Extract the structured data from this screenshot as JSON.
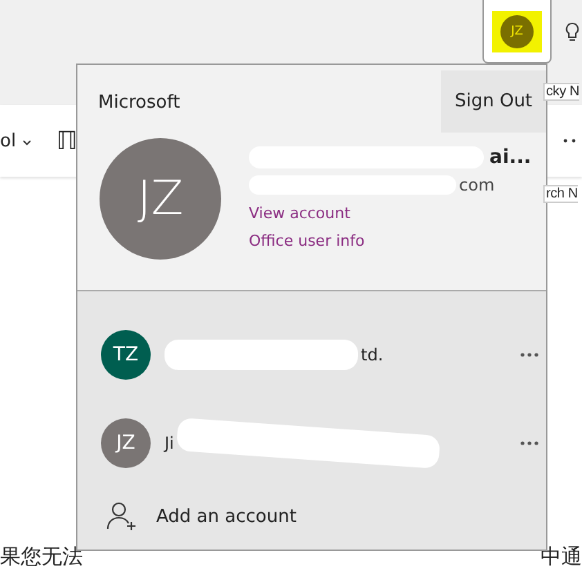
{
  "toolbar": {
    "avatar_initials": "JZ",
    "highlighted": true,
    "ribbon_items": [
      "ol",
      "ℿ"
    ],
    "side_labels": [
      "cky N",
      "rch N"
    ]
  },
  "document": {
    "text_left": "果您无法",
    "text_right": "中通"
  },
  "account_menu": {
    "brand": "Microsoft",
    "sign_out": "Sign Out",
    "profile": {
      "initials": "JZ",
      "color": "#7a7574",
      "name_fragment": "ai...",
      "email_fragment": "com",
      "links": [
        "View account",
        "Office user info"
      ]
    },
    "accounts": [
      {
        "initials": "TZ",
        "color": "#005e50",
        "name_fragment": "td."
      },
      {
        "initials": "JZ",
        "color": "#7a7574",
        "name_fragment": "Ji"
      }
    ],
    "add_account": "Add an account"
  }
}
